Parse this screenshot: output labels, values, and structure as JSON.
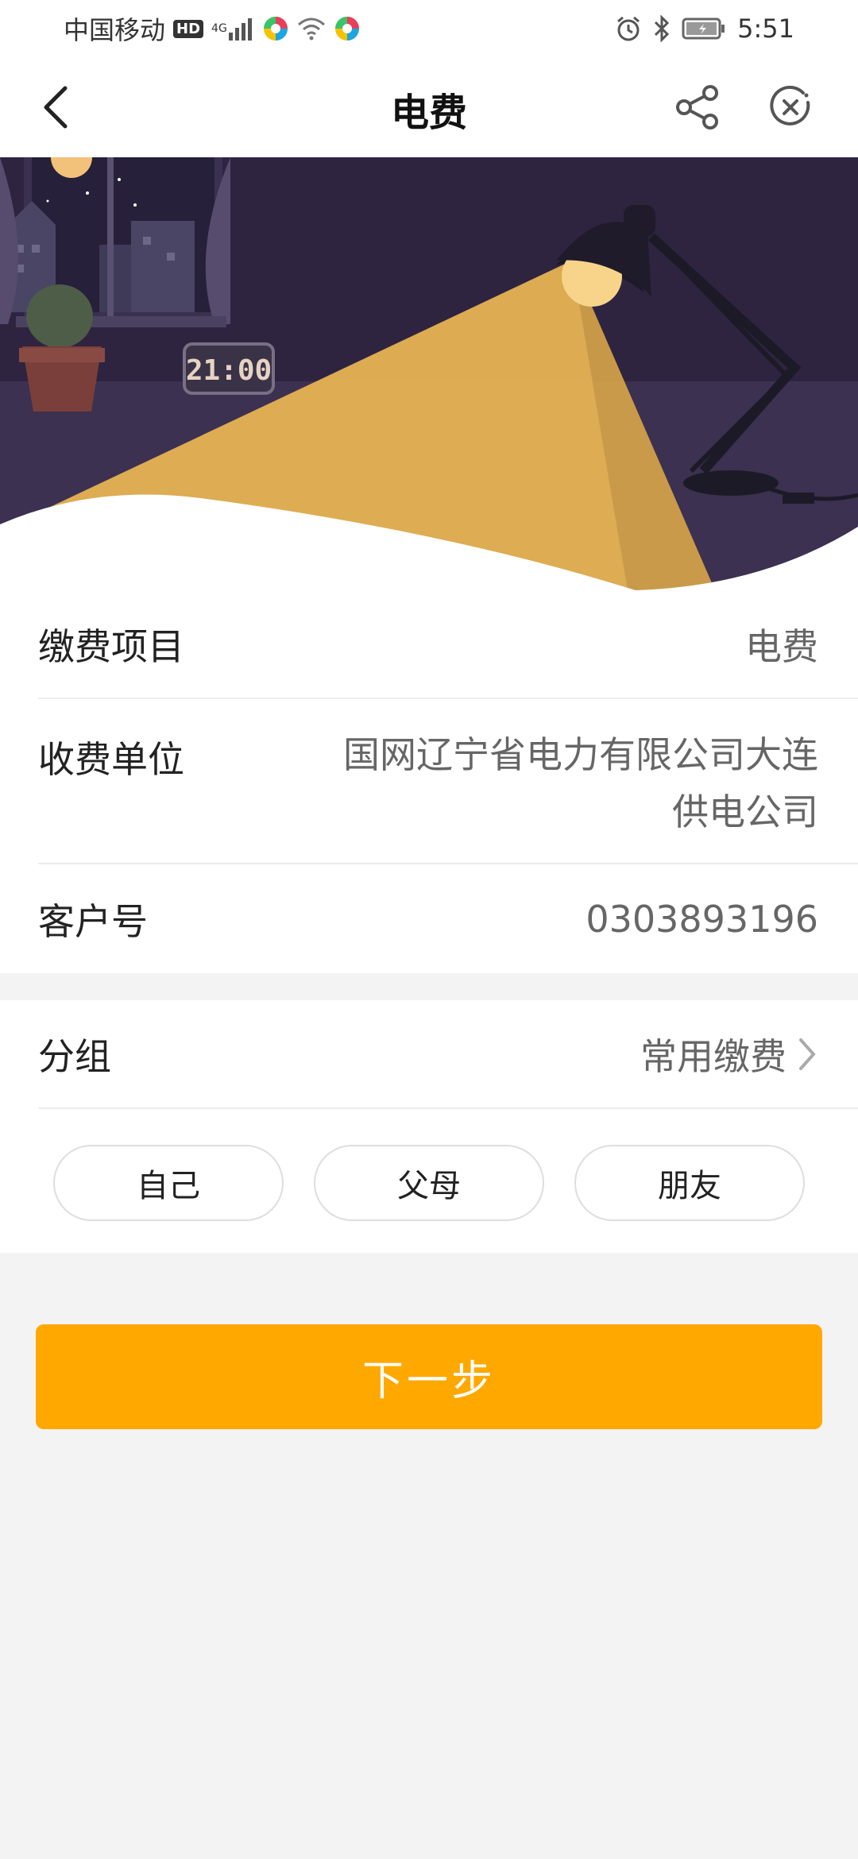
{
  "status_bar": {
    "carrier": "中国移动",
    "hd": "HD",
    "network": "4G",
    "time": "5:51"
  },
  "header": {
    "title": "电费"
  },
  "banner": {
    "clock_text": "21:00",
    "colors": {
      "sky": "#2e2440",
      "floor": "#3c3150",
      "light": "#d6a34a"
    }
  },
  "info": {
    "item_label": "缴费项目",
    "item_value": "电费",
    "unit_label": "收费单位",
    "unit_value": "国网辽宁省电力有限公司大连供电公司",
    "customer_label": "客户号",
    "customer_value": "0303893196"
  },
  "group": {
    "label": "分组",
    "value": "常用缴费",
    "chips": [
      "自己",
      "父母",
      "朋友"
    ]
  },
  "actions": {
    "next_label": "下一步",
    "accent": "#ffa800"
  }
}
